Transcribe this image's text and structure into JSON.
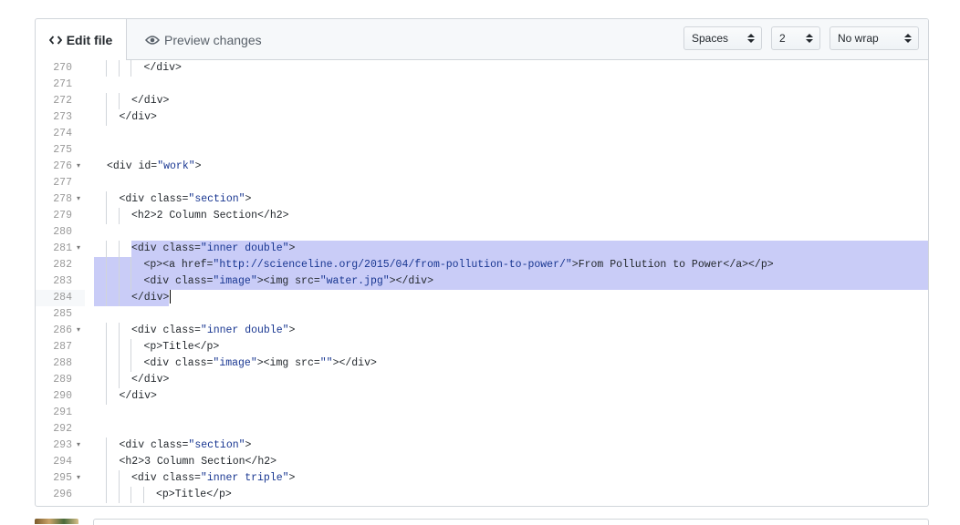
{
  "tabs": {
    "edit_label": "Edit file",
    "preview_label": "Preview changes"
  },
  "controls": {
    "indent_mode": "Spaces",
    "indent_size": "2",
    "wrap_mode": "No wrap"
  },
  "colors": {
    "selection": "#c9ccf7",
    "string": "#183691",
    "accent": "#24292e"
  },
  "editor": {
    "current_line": 284,
    "lines": [
      {
        "n": "270",
        "indent": 3,
        "fold": false,
        "text": "</div>"
      },
      {
        "n": "271",
        "indent": 0,
        "fold": false,
        "text": ""
      },
      {
        "n": "272",
        "indent": 2,
        "fold": false,
        "text": "</div>"
      },
      {
        "n": "273",
        "indent": 1,
        "fold": false,
        "text": "</div>"
      },
      {
        "n": "274",
        "indent": 0,
        "fold": false,
        "text": ""
      },
      {
        "n": "275",
        "indent": 0,
        "fold": false,
        "text": ""
      },
      {
        "n": "276",
        "indent": 0,
        "fold": true,
        "text": "<div id=\"work\">"
      },
      {
        "n": "277",
        "indent": 0,
        "fold": false,
        "text": ""
      },
      {
        "n": "278",
        "indent": 1,
        "fold": true,
        "text": "<div class=\"section\">"
      },
      {
        "n": "279",
        "indent": 2,
        "fold": false,
        "text": "<h2>2 Column Section</h2>"
      },
      {
        "n": "280",
        "indent": 0,
        "fold": false,
        "text": ""
      },
      {
        "n": "281",
        "indent": 2,
        "fold": true,
        "text": "<div class=\"inner double\">",
        "sel": "partial"
      },
      {
        "n": "282",
        "indent": 3,
        "fold": false,
        "text": "<p><a href=\"http://scienceline.org/2015/04/from-pollution-to-power/\">From Pollution to Power</a></p>",
        "sel": "full"
      },
      {
        "n": "283",
        "indent": 3,
        "fold": false,
        "text": "<div class=\"image\"><img src=\"water.jpg\"></div>",
        "sel": "full"
      },
      {
        "n": "284",
        "indent": 2,
        "fold": false,
        "text": "</div>",
        "sel": "end"
      },
      {
        "n": "285",
        "indent": 0,
        "fold": false,
        "text": ""
      },
      {
        "n": "286",
        "indent": 2,
        "fold": true,
        "text": "<div class=\"inner double\">"
      },
      {
        "n": "287",
        "indent": 3,
        "fold": false,
        "text": "<p>Title</p>"
      },
      {
        "n": "288",
        "indent": 3,
        "fold": false,
        "text": "<div class=\"image\"><img src=\"\"></div>"
      },
      {
        "n": "289",
        "indent": 2,
        "fold": false,
        "text": "</div>"
      },
      {
        "n": "290",
        "indent": 1,
        "fold": false,
        "text": "</div>"
      },
      {
        "n": "291",
        "indent": 0,
        "fold": false,
        "text": ""
      },
      {
        "n": "292",
        "indent": 0,
        "fold": false,
        "text": ""
      },
      {
        "n": "293",
        "indent": 1,
        "fold": true,
        "text": "<div class=\"section\">"
      },
      {
        "n": "294",
        "indent": 1,
        "fold": false,
        "text": "<h2>3 Column Section</h2>"
      },
      {
        "n": "295",
        "indent": 2,
        "fold": true,
        "text": "<div class=\"inner triple\">"
      },
      {
        "n": "296",
        "indent": 4,
        "fold": false,
        "text": "<p>Title</p>"
      }
    ]
  }
}
